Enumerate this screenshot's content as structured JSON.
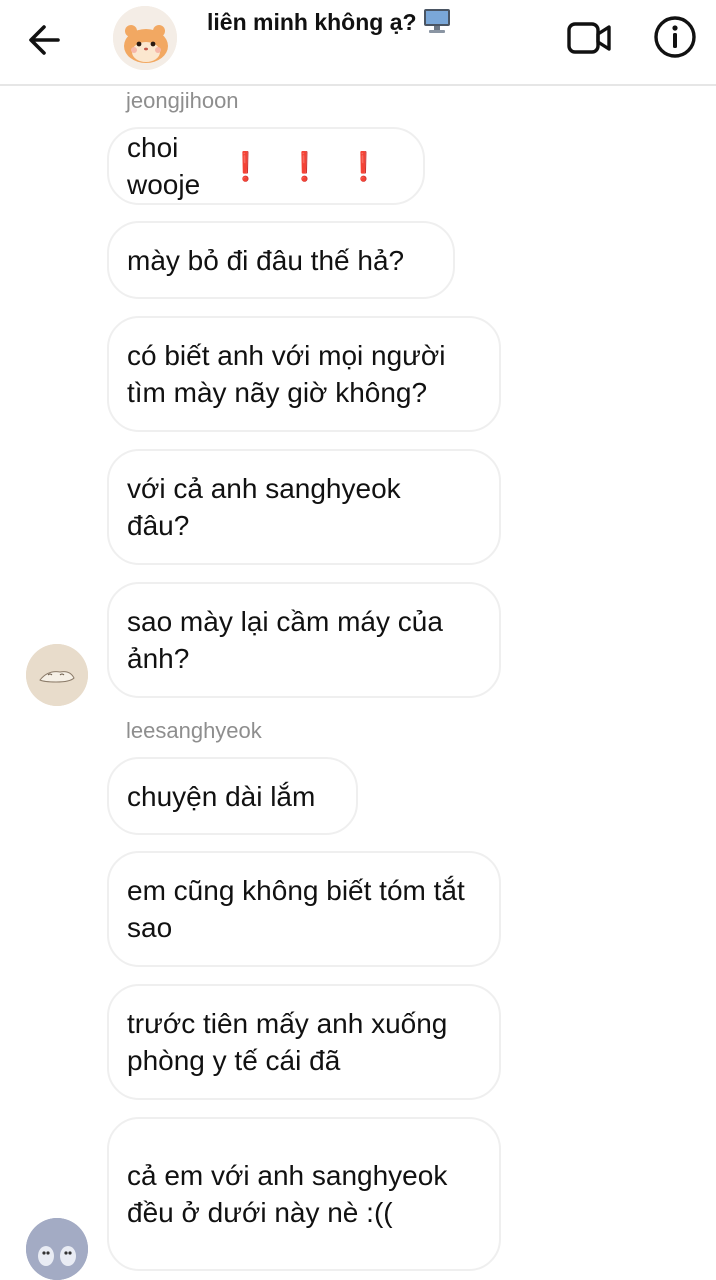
{
  "header": {
    "title": "liên minh không ạ?",
    "title_emoji_icon": "desktop-computer-icon",
    "back_icon": "arrow-left-icon",
    "video_icon": "video-camera-icon",
    "info_icon": "info-icon"
  },
  "groups": [
    {
      "sender": "jeongjihoon",
      "messages": [
        {
          "text": "choi wooje",
          "emphasis": "❗❗❗"
        },
        {
          "text": "mày bỏ đi đâu thế hả?"
        },
        {
          "text": "có biết anh với mọi người tìm mày nãy giờ không?"
        },
        {
          "text": "với cả anh sanghyeok đâu?"
        },
        {
          "text": "sao mày lại cầm máy của ảnh?"
        }
      ]
    },
    {
      "sender": "leesanghyeok",
      "messages": [
        {
          "text": "chuyện dài lắm"
        },
        {
          "text": "em cũng không biết tóm tắt sao"
        },
        {
          "text": "trước tiên mấy anh xuống phòng y tế cái đã"
        },
        {
          "text": "cả em với anh sanghyeok đều ở dưới này nè :(("
        }
      ]
    }
  ],
  "colors": {
    "accent_red": "#e02424",
    "meta_gray": "#8e8e8e",
    "bubble_border": "#efefef"
  }
}
